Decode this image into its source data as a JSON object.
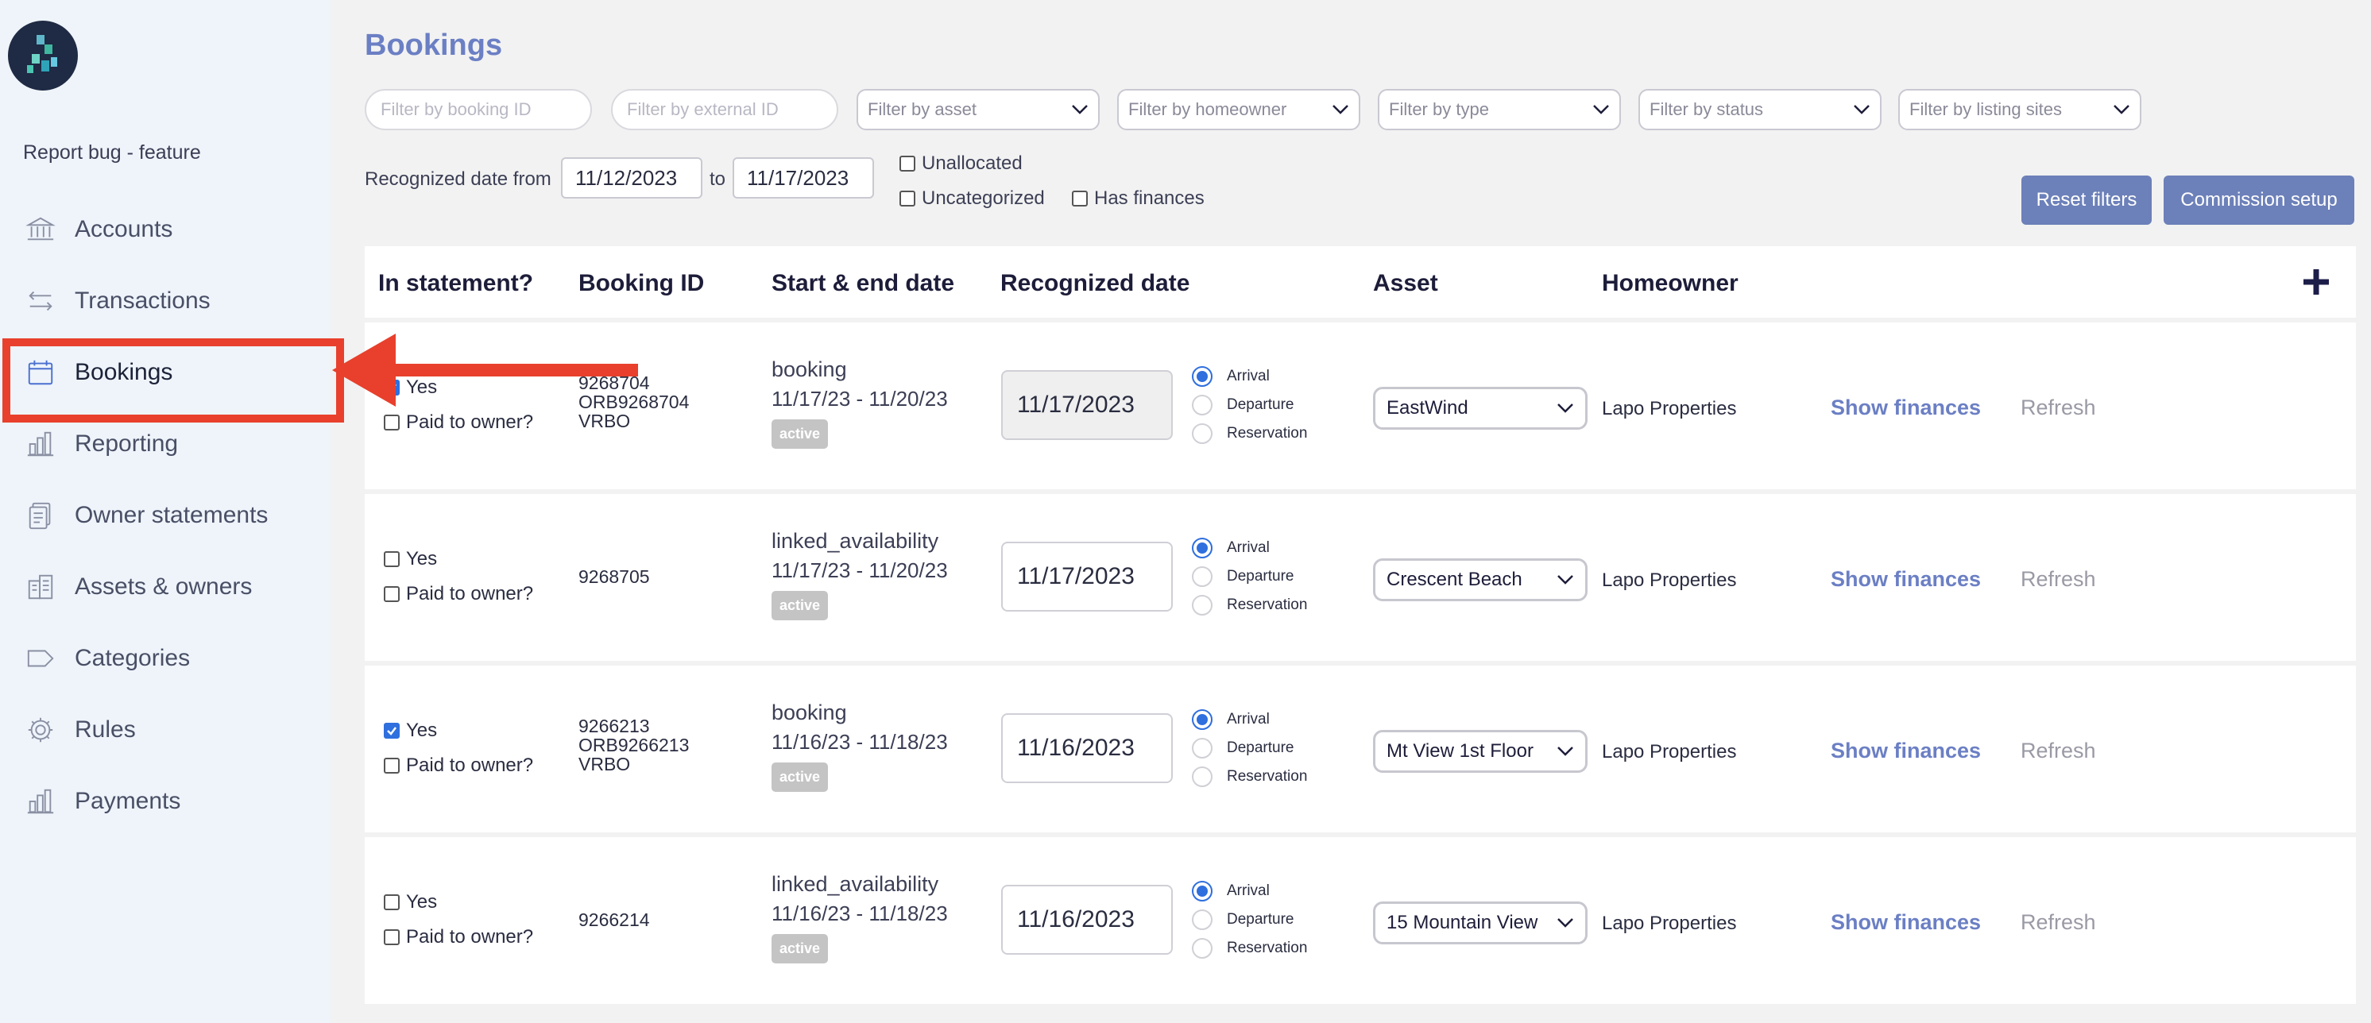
{
  "sidebar": {
    "report_link": "Report bug - feature",
    "items": [
      {
        "label": "Accounts",
        "icon": "bank-icon"
      },
      {
        "label": "Transactions",
        "icon": "transfer-arrows-icon"
      },
      {
        "label": "Bookings",
        "icon": "calendar-icon",
        "active": true
      },
      {
        "label": "Reporting",
        "icon": "bar-chart-icon"
      },
      {
        "label": "Owner statements",
        "icon": "documents-icon"
      },
      {
        "label": "Assets & owners",
        "icon": "buildings-icon"
      },
      {
        "label": "Categories",
        "icon": "tag-icon"
      },
      {
        "label": "Rules",
        "icon": "gear-icon"
      },
      {
        "label": "Payments",
        "icon": "bar-chart-icon"
      }
    ]
  },
  "page": {
    "title": "Bookings"
  },
  "filters": {
    "booking_id_placeholder": "Filter by booking ID",
    "external_id_placeholder": "Filter by external ID",
    "asset": "Filter by asset",
    "homeowner": "Filter by homeowner",
    "type": "Filter by type",
    "status": "Filter by status",
    "listing_sites": "Filter by listing sites",
    "date_from_label": "Recognized date from",
    "date_from": "11/12/2023",
    "to_label": "to",
    "date_to": "11/17/2023",
    "unallocated": "Unallocated",
    "uncategorized": "Uncategorized",
    "has_finances": "Has finances",
    "reset_label": "Reset filters",
    "commission_label": "Commission setup"
  },
  "table": {
    "headers": {
      "in_statement": "In statement?",
      "booking_id": "Booking ID",
      "start_end": "Start & end date",
      "recognized": "Recognized date",
      "asset": "Asset",
      "homeowner": "Homeowner"
    },
    "yes_label": "Yes",
    "paid_label": "Paid to owner?",
    "arrival_label": "Arrival",
    "departure_label": "Departure",
    "reservation_label": "Reservation",
    "show_finances_label": "Show finances",
    "refresh_label": "Refresh",
    "rows": [
      {
        "in_statement": true,
        "paid": false,
        "ids": [
          "9268704",
          "ORB9268704",
          "VRBO"
        ],
        "type": "booking",
        "dates": "11/17/23 - 11/20/23",
        "status": "active",
        "recognized": "11/17/2023",
        "recognized_disabled": true,
        "asset": "EastWind",
        "homeowner": "Lapo Properties"
      },
      {
        "in_statement": false,
        "paid": false,
        "ids": [
          "9268705"
        ],
        "type": "linked_availability",
        "dates": "11/17/23 - 11/20/23",
        "status": "active",
        "recognized": "11/17/2023",
        "recognized_disabled": false,
        "asset": "Crescent Beach",
        "homeowner": "Lapo Properties"
      },
      {
        "in_statement": true,
        "paid": false,
        "ids": [
          "9266213",
          "ORB9266213",
          "VRBO"
        ],
        "type": "booking",
        "dates": "11/16/23 - 11/18/23",
        "status": "active",
        "recognized": "11/16/2023",
        "recognized_disabled": false,
        "asset": "Mt View 1st Floor",
        "homeowner": "Lapo Properties"
      },
      {
        "in_statement": false,
        "paid": false,
        "ids": [
          "9266214"
        ],
        "type": "linked_availability",
        "dates": "11/16/23 - 11/18/23",
        "status": "active",
        "recognized": "11/16/2023",
        "recognized_disabled": false,
        "asset": "15 Mountain View",
        "homeowner": "Lapo Properties"
      }
    ]
  },
  "colors": {
    "accent": "#6b7fc4",
    "button": "#6c80b9",
    "annotation": "#e8402c",
    "checkbox": "#2f6fde"
  }
}
